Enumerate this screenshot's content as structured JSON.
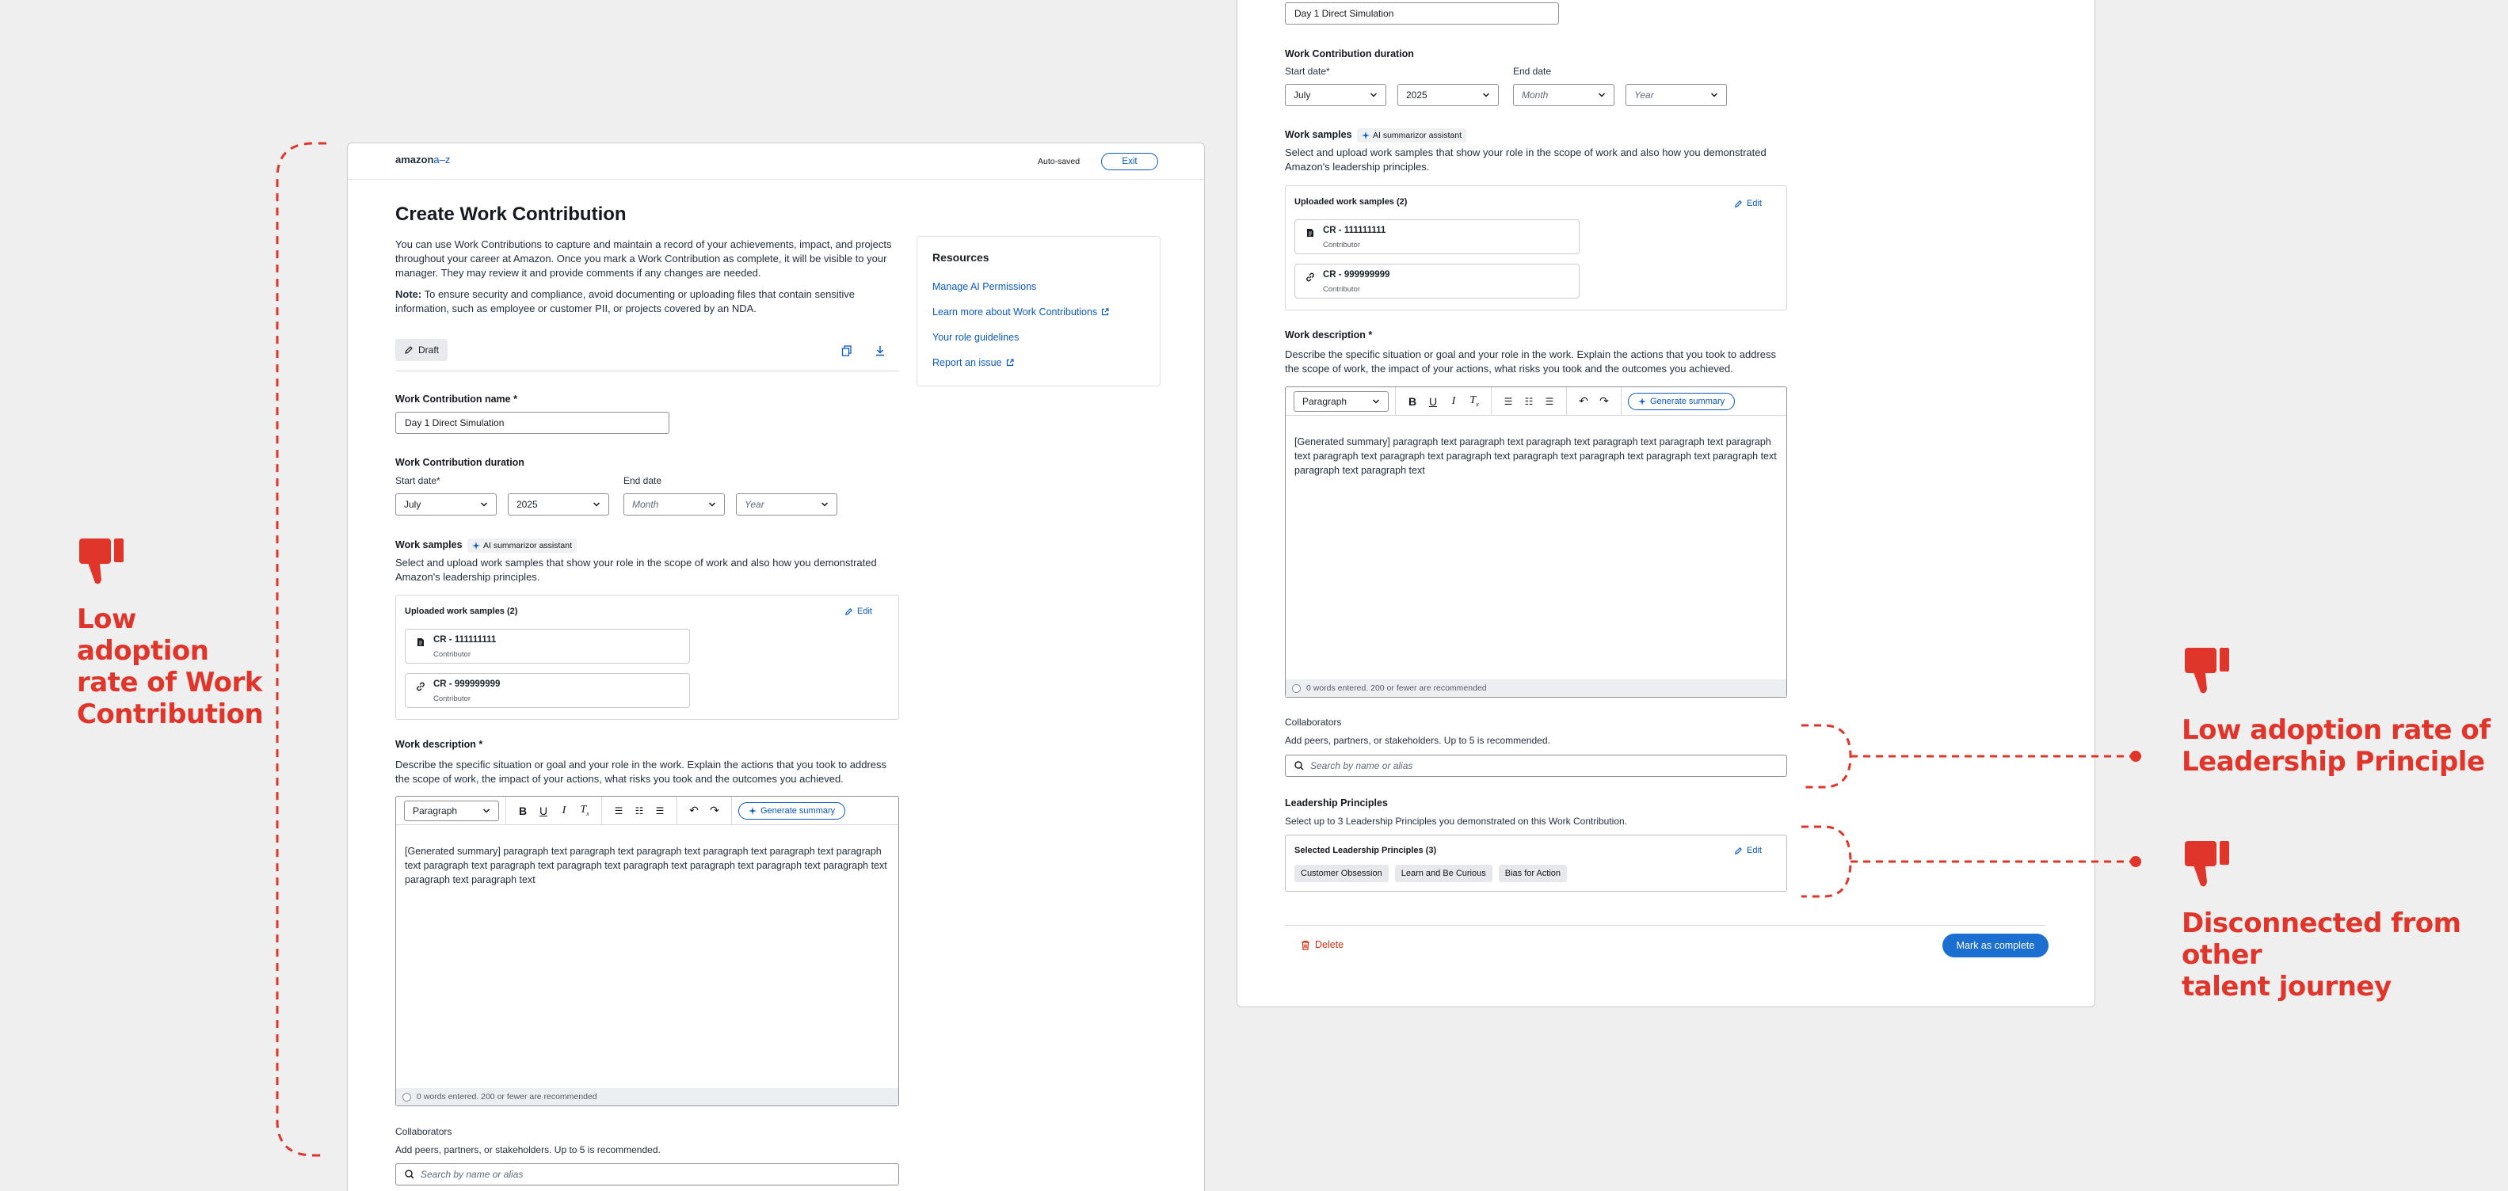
{
  "annotations": {
    "left_callout": "Low adoption rate of Work Contribution",
    "left_lines": [
      "Low adoption",
      "rate of Work",
      "Contribution"
    ],
    "right_callout_1_lines": [
      "Low adoption rate of",
      "Leadership Principle"
    ],
    "right_callout_2_lines": [
      "Disconnected from",
      "other",
      "talent journey"
    ],
    "thumb_icon": "thumbs-down-icon",
    "accent_color": "#e0352b"
  },
  "header": {
    "logo_text": "amazon",
    "logo_suffix": "a–z",
    "autosave": "Auto-saved",
    "exit_label": "Exit"
  },
  "form": {
    "title": "Create Work Contribution",
    "intro": "You can use Work Contributions to capture and maintain a record of your achievements, impact, and projects throughout your career at Amazon. Once you mark a Work Contribution as complete, it will be visible to your manager. They may review it and provide comments if any changes are needed.",
    "note_label": "Note:",
    "note_text": " To ensure security and compliance, avoid documenting or uploading files that contain sensitive information, such as employee or customer PII, or projects covered by an NDA.",
    "draft_label": "Draft",
    "name_label": "Work Contribution name *",
    "name_value": "Day 1 Direct Simulation",
    "duration_label": "Work Contribution duration",
    "start_label": "Start date*",
    "end_label": "End date",
    "start_month": "July",
    "start_year": "2025",
    "end_month_ph": "Month",
    "end_year_ph": "Year",
    "samples_label": "Work samples",
    "ai_badge": "AI summarizor assistant",
    "samples_desc": "Select and upload work samples that show your role in the scope of work and also how you demonstrated Amazon's leadership principles.",
    "uploaded_label": "Uploaded work samples (2)",
    "edit_label": "Edit",
    "samples": [
      {
        "title": "CR - 111111111",
        "role": "Contributor",
        "icon": "document-icon"
      },
      {
        "title": "CR - 999999999",
        "role": "Contributor",
        "icon": "link-icon"
      }
    ],
    "desc_label": "Work description *",
    "desc_help": "Describe the specific situation or goal and your role in the work. Explain the actions that you took to address the scope of work, the impact of your actions, what risks you took and the outcomes you achieved.",
    "editor_style": "Paragraph",
    "generate_label": "Generate summary",
    "editor_text": "[Generated summary] paragraph text paragraph text paragraph text paragraph text paragraph text paragraph text paragraph text paragraph text paragraph text paragraph text paragraph text paragraph text paragraph text paragraph text paragraph text",
    "word_count": "0 words entered. 200 or fewer are recommended",
    "collab_label": "Collaborators",
    "collab_desc": "Add peers, partners, or stakeholders. Up to 5 is recommended.",
    "collab_ph": "Search by name or alias",
    "lp_label": "Leadership Principles",
    "lp_desc": "Select up to 3 Leadership Principles you demonstrated on this Work Contribution.",
    "lp_selected": "Selected Leadership Principles (3)",
    "lp_tags": [
      "Customer Obsession",
      "Learn and Be Curious",
      "Bias for Action"
    ],
    "delete_label": "Delete",
    "complete_label": "Mark as complete"
  },
  "resources": {
    "title": "Resources",
    "links": [
      "Manage AI Permissions",
      "Learn more about Work Contributions",
      "Your role guidelines",
      "Report an issue"
    ]
  }
}
